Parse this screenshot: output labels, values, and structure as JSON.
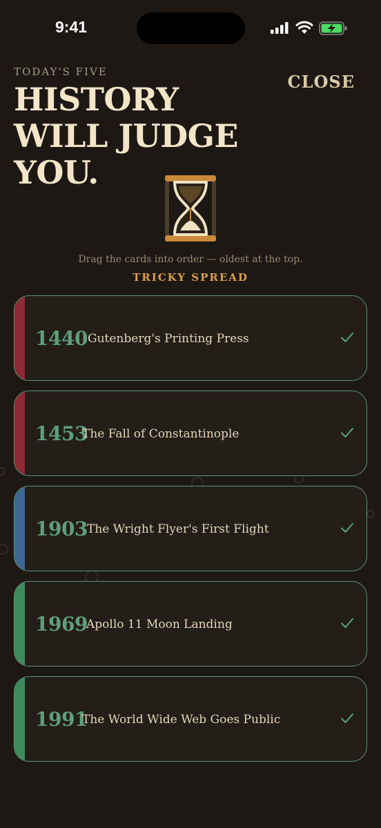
{
  "status": {
    "time": "9:41"
  },
  "header": {
    "eyebrow": "TODAY'S FIVE",
    "title": "HISTORY WILL JUDGE YOU.",
    "close_label": "CLOSE"
  },
  "instructions": {
    "hint": "Drag the cards into order — oldest at the top.",
    "difficulty": "TRICKY SPREAD"
  },
  "cards": [
    {
      "year": "1440",
      "label": "Gutenberg's Printing Press",
      "stripe": "#8c2a36",
      "icon": "check-icon"
    },
    {
      "year": "1453",
      "label": "The Fall of Constantinople",
      "stripe": "#8c2a36",
      "icon": "check-icon"
    },
    {
      "year": "1903",
      "label": "The Wright Flyer's First Flight",
      "stripe": "#3f6794",
      "icon": "check-icon"
    },
    {
      "year": "1969",
      "label": "Apollo 11 Moon Landing",
      "stripe": "#3f8a5c",
      "icon": "check-icon"
    },
    {
      "year": "1991",
      "label": "The World Wide Web Goes Public",
      "stripe": "#3f8a5c",
      "icon": "check-icon"
    }
  ],
  "colors": {
    "background": "#1d1814",
    "card": "#241e19",
    "card_border": "#5f9376",
    "accent_gold": "#d9a04a",
    "year_green": "#5f9f7a"
  }
}
